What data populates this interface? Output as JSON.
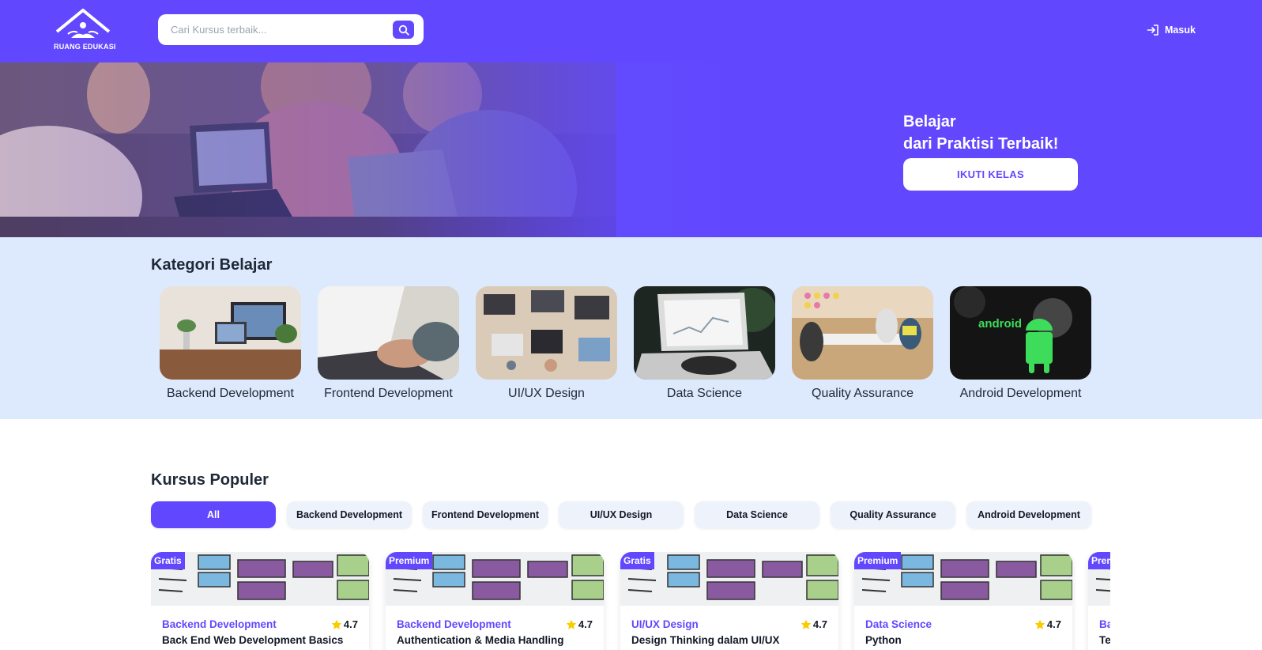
{
  "header": {
    "logo_text": "RUANG EDUKASI",
    "search_placeholder": "Cari Kursus terbaik...",
    "login_label": "Masuk",
    "accent_color": "#6148FF"
  },
  "hero": {
    "title_line1": "Belajar",
    "title_line2": "dari Praktisi Terbaik!",
    "button_label": "IKUTI KELAS"
  },
  "categories": {
    "title": "Kategori Belajar",
    "items": [
      {
        "label": "Backend Development"
      },
      {
        "label": "Frontend Development"
      },
      {
        "label": "UI/UX Design"
      },
      {
        "label": "Data Science"
      },
      {
        "label": "Quality Assurance"
      },
      {
        "label": "Android Development"
      }
    ]
  },
  "popular": {
    "title": "Kursus Populer",
    "filters": [
      "All",
      "Backend Development",
      "Frontend Development",
      "UI/UX Design",
      "Data Science",
      "Quality Assurance",
      "Android Development"
    ],
    "active_filter": "All",
    "courses": [
      {
        "badge": "Gratis",
        "category": "Backend Development",
        "rating": "4.7",
        "title": "Back End Web Development Basics"
      },
      {
        "badge": "Premium",
        "category": "Backend Development",
        "rating": "4.7",
        "title": "Authentication & Media Handling"
      },
      {
        "badge": "Gratis",
        "category": "UI/UX Design",
        "rating": "4.7",
        "title": "Design Thinking dalam UI/UX"
      },
      {
        "badge": "Premium",
        "category": "Data Science",
        "rating": "4.7",
        "title": "Python"
      },
      {
        "badge": "Prem",
        "category": "Ba",
        "rating": "",
        "title": "Te"
      }
    ]
  }
}
